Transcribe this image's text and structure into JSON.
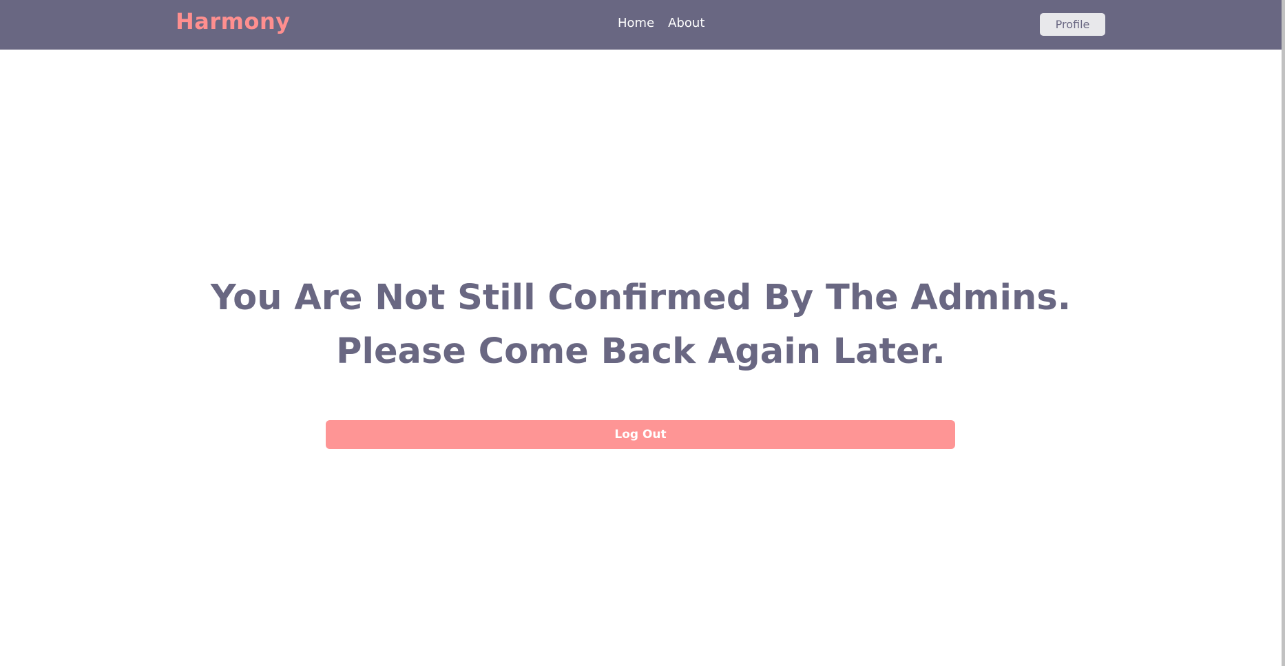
{
  "navbar": {
    "brand": "Harmony",
    "links": [
      "Home",
      "About"
    ],
    "profile_label": "Profile",
    "background_color": "#696782",
    "brand_color": "#fe8f8f"
  },
  "main": {
    "message_line1": "You Are Not Still Confirmed By The Admins.",
    "message_line2": "Please Come Back Again Later.",
    "logout_label": "Log Out",
    "text_color": "#696782",
    "button_color": "#fe9595"
  }
}
